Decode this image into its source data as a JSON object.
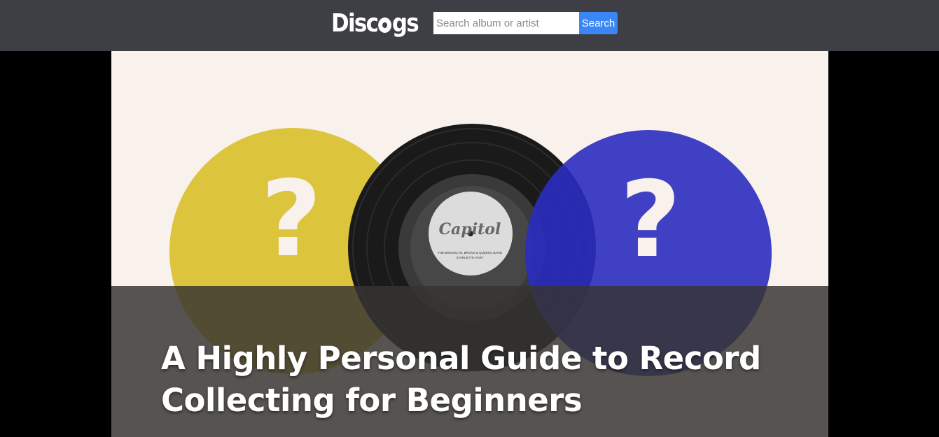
{
  "header": {
    "logo_text": "Discogs",
    "search": {
      "placeholder": "Search album or artist",
      "value": "",
      "button_label": "Search"
    }
  },
  "hero": {
    "headline": "A Highly Personal Guide to Record Collecting for Beginners",
    "left_disc": {
      "symbol": "?",
      "color": "#dcc43c"
    },
    "right_disc": {
      "symbol": "?",
      "color": "#3a3cc4"
    },
    "record_label": {
      "brand": "Capitol",
      "artist": "THE BROOKLYN, BRONX & QUEENS BAND",
      "track": "STARLETTE HART"
    }
  },
  "colors": {
    "topbar": "#3d3f44",
    "search_button": "#3b86f5",
    "hero_background": "#f8f1ec"
  }
}
